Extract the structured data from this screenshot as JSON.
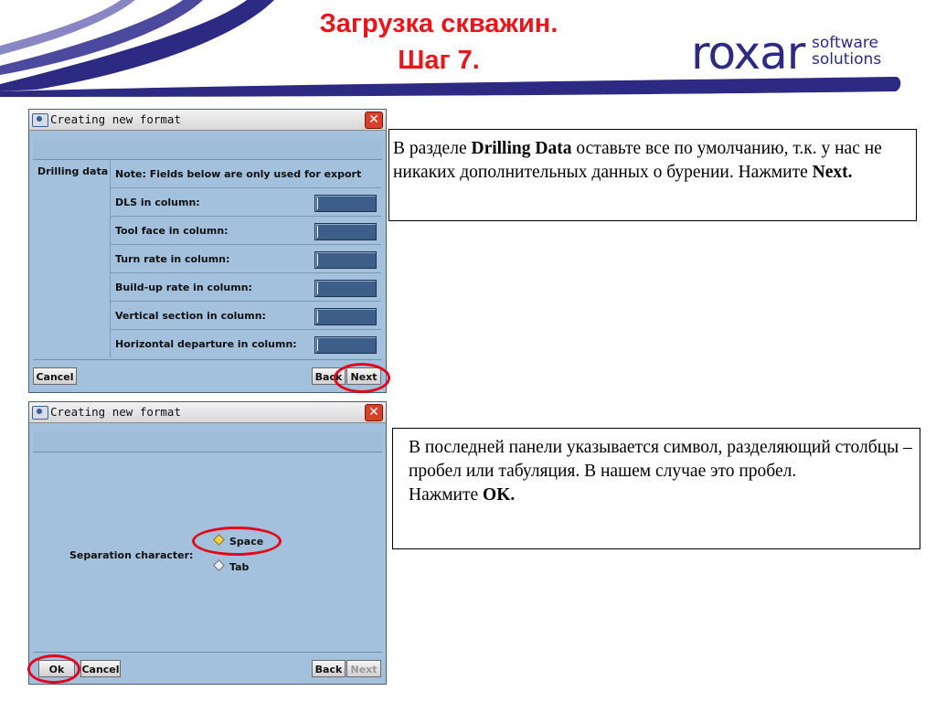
{
  "slide": {
    "title_line1": "Загрузка скважин.",
    "title_line2": "Шаг 7.",
    "logo_main": "roxar",
    "logo_sub1": "software",
    "logo_sub2": "solutions",
    "colors": {
      "title": "#e8161b",
      "swoosh": "#2c2a82",
      "dialog_bg": "#a3c1dd",
      "highlight_oval": "#e3061a"
    }
  },
  "dialog1": {
    "window_title": "Creating new format",
    "title_icon": "eye-icon",
    "section_label": "Drilling data",
    "rows": [
      {
        "label": "Note: Fields below are only used for export",
        "has_field": false
      },
      {
        "label": "DLS in column:",
        "has_field": true
      },
      {
        "label": "Tool face in column:",
        "has_field": true
      },
      {
        "label": "Turn rate in column:",
        "has_field": true
      },
      {
        "label": "Build-up rate in column:",
        "has_field": true
      },
      {
        "label": "Vertical section in column:",
        "has_field": true
      },
      {
        "label": "Horizontal departure in column:",
        "has_field": true
      }
    ],
    "buttons": {
      "cancel": "Cancel",
      "back": "Back",
      "next": "Next"
    }
  },
  "dialog2": {
    "window_title": "Creating new format",
    "separation_label": "Separation character:",
    "options": [
      {
        "label": "Space",
        "selected": true
      },
      {
        "label": "Tab",
        "selected": false
      }
    ],
    "buttons": {
      "ok": "Ok",
      "cancel": "Cancel",
      "back": "Back",
      "next": "Next"
    }
  },
  "callout1": {
    "text_before": "В разделе ",
    "bold1": "Drilling Data",
    "text_middle": " оставьте все по умолчанию, т.к. у нас не никаких дополнительных данных о бурении. Нажмите ",
    "bold2": "Next."
  },
  "callout2": {
    "line1": "В последней панели указывается символ, разделяющий столбцы – пробел или табуляция. В нашем случае это пробел.",
    "text_before": "Нажмите ",
    "bold": "OK."
  }
}
